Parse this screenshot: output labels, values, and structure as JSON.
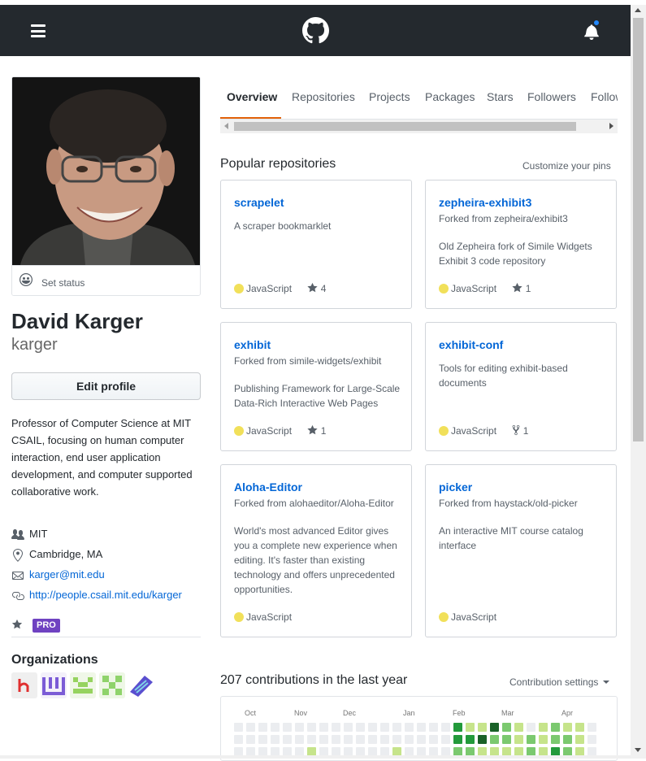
{
  "header": {
    "menu_icon": "hamburger-icon",
    "logo_icon": "github-mark-icon",
    "notifications_icon": "bell-icon",
    "colors": {
      "bg": "#24292e",
      "dot": "#2188ff"
    }
  },
  "profile": {
    "set_status": "Set status",
    "name": "David Karger",
    "login": "karger",
    "edit_profile": "Edit profile",
    "bio": "Professor of Computer Science at MIT CSAIL, focusing on human computer interaction, end user application development, and computer supported collaborative work.",
    "company": "MIT",
    "location": "Cambridge, MA",
    "email": "karger@mit.edu",
    "website": "http://people.csail.mit.edu/karger",
    "pro_badge": "PRO",
    "organizations_title": "Organizations"
  },
  "tabs": [
    {
      "label": "Overview",
      "active": true
    },
    {
      "label": "Repositories"
    },
    {
      "label": "Projects"
    },
    {
      "label": "Packages"
    },
    {
      "label": "Stars"
    },
    {
      "label": "Followers"
    },
    {
      "label": "Following"
    }
  ],
  "popular": {
    "title": "Popular repositories",
    "customize": "Customize your pins",
    "repos": [
      {
        "name": "scrapelet",
        "fork": "",
        "desc1": "A scraper bookmarklet",
        "desc2": "",
        "desc3": "",
        "desc4": "",
        "desc5": "",
        "lang": "JavaScript",
        "stat_icon": "star-icon",
        "stat": "4"
      },
      {
        "name": "zepheira-exhibit3",
        "fork": "Forked from zepheira/exhibit3",
        "desc1": "Old Zepheira fork of Simile Widgets",
        "desc2": "Exhibit 3 code repository",
        "desc3": "",
        "desc4": "",
        "desc5": "",
        "lang": "JavaScript",
        "stat_icon": "star-icon",
        "stat": "1"
      },
      {
        "name": "exhibit",
        "fork": "Forked from simile-widgets/exhibit",
        "desc1": "Publishing Framework for Large-Scale",
        "desc2": "Data-Rich Interactive Web Pages",
        "desc3": "",
        "desc4": "",
        "desc5": "",
        "lang": "JavaScript",
        "stat_icon": "star-icon",
        "stat": "1"
      },
      {
        "name": "exhibit-conf",
        "fork": "",
        "desc1": "Tools for editing exhibit-based",
        "desc2": "documents",
        "desc3": "",
        "desc4": "",
        "desc5": "",
        "lang": "JavaScript",
        "stat_icon": "fork-icon",
        "stat": "1"
      },
      {
        "name": "Aloha-Editor",
        "fork": "Forked from alohaeditor/Aloha-Editor",
        "desc1": "World's most advanced Editor gives",
        "desc2": "you a complete new experience when",
        "desc3": "editing. It's faster than existing",
        "desc4": "technology and offers unprecedented",
        "desc5": "opportunities.",
        "lang": "JavaScript",
        "stat_icon": "",
        "stat": ""
      },
      {
        "name": "picker",
        "fork": "Forked from haystack/old-picker",
        "desc1": "An interactive MIT course catalog",
        "desc2": "interface",
        "desc3": "",
        "desc4": "",
        "desc5": "",
        "lang": "JavaScript",
        "stat_icon": "",
        "stat": ""
      }
    ],
    "lang_color": "#f1e05a"
  },
  "contributions": {
    "title": "207 contributions in the last year",
    "settings": "Contribution settings",
    "months": [
      "Oct",
      "Nov",
      "Dec",
      "Jan",
      "Feb",
      "Mar",
      "Apr"
    ],
    "colors": [
      "#ebedf0",
      "#c6e48b",
      "#7bc96f",
      "#239a3b",
      "#196127"
    ]
  }
}
